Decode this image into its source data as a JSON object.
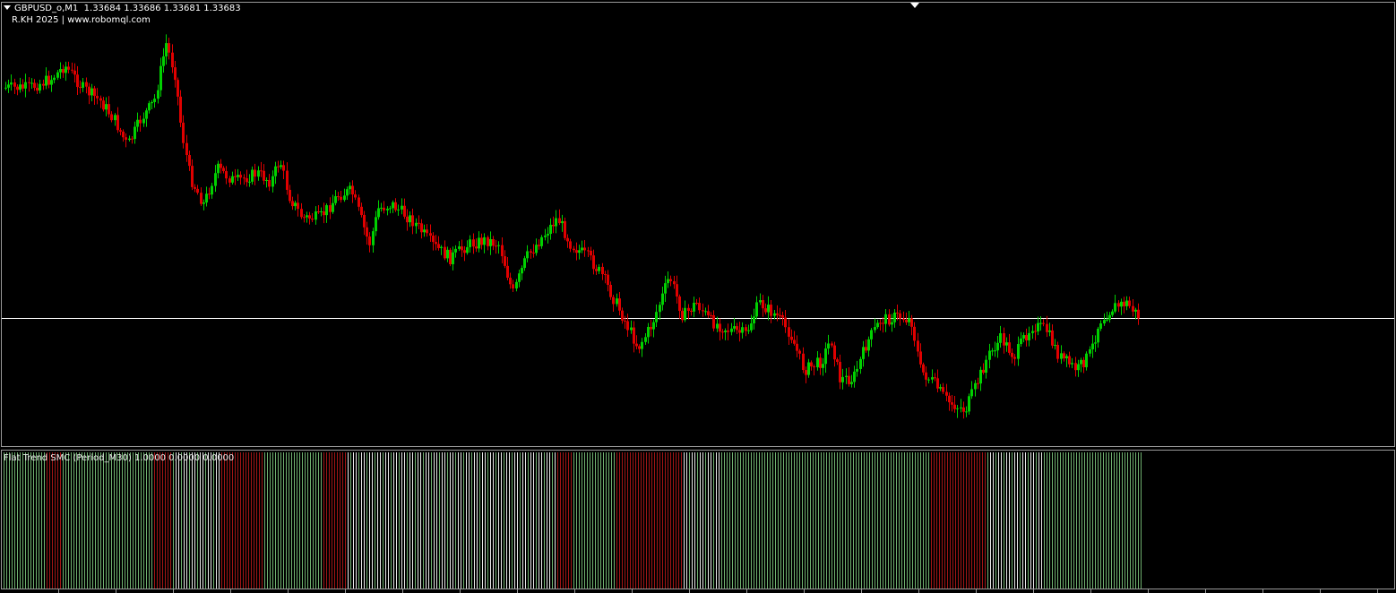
{
  "chart": {
    "symbol_timeframe": "GBPUSD_o,M1",
    "ohlc": "1.33684 1.33686 1.33681 1.33683",
    "brand": "R.KH 2025 | www.robomql.com",
    "bid_price": 1.33683
  },
  "indicator": {
    "label": "Flat Trend SMC (Period_M30) 1.0000 0.0000 0.0000"
  },
  "colors": {
    "background": "#000000",
    "bull": "#00d000",
    "bear": "#e00000",
    "bid_line": "#ffffff",
    "trend_up": "#6fb06f",
    "trend_down": "#a01515",
    "trend_flat": "#e8e8e8"
  },
  "icons": {
    "header_arrow": "triangle-down-icon",
    "shift_marker": "chart-shift-triangle-icon"
  }
}
